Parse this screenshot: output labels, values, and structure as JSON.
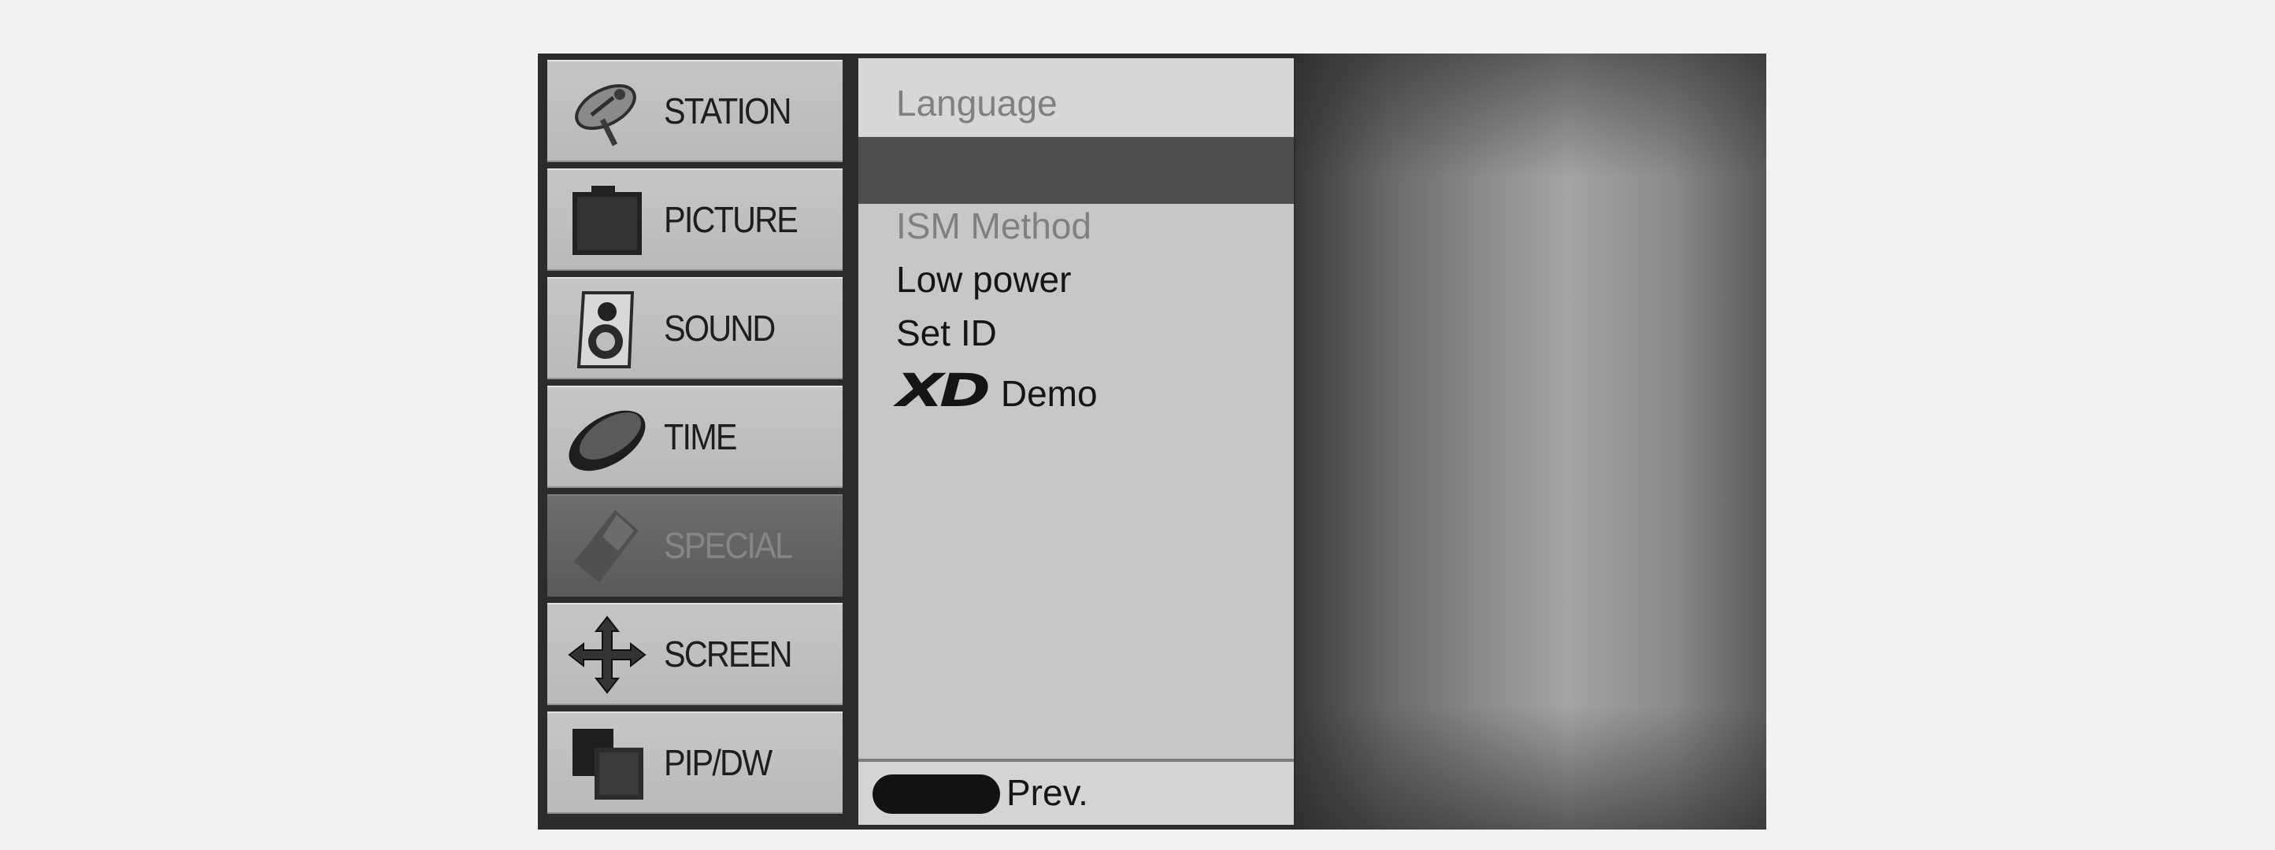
{
  "sidebar": {
    "items": [
      {
        "label": "STATION",
        "icon": "satellite-dish-icon"
      },
      {
        "label": "PICTURE",
        "icon": "picture-icon"
      },
      {
        "label": "SOUND",
        "icon": "speaker-icon"
      },
      {
        "label": "TIME",
        "icon": "clock-icon"
      },
      {
        "label": "SPECIAL",
        "icon": "special-icon",
        "selected": true
      },
      {
        "label": "SCREEN",
        "icon": "move-arrows-icon"
      },
      {
        "label": "PIP/DW",
        "icon": "pip-icon"
      }
    ]
  },
  "menu": {
    "items": [
      {
        "label": "Language",
        "dimmed": true
      },
      {
        "label": "ISM Method",
        "dimmed": true
      },
      {
        "label": "Low power"
      },
      {
        "label": "Set ID"
      }
    ],
    "xd_logo": "XD",
    "demo_label": "Demo"
  },
  "footer": {
    "prev_label": "Prev.",
    "prev_button_color": "#121212"
  },
  "colors": {
    "panel": "#c7c7c7",
    "selected_band": "#4e4e4e",
    "sidebar_item": "#c0c0c0",
    "sidebar_selected": "#626262",
    "frame": "#2c2c2c"
  }
}
